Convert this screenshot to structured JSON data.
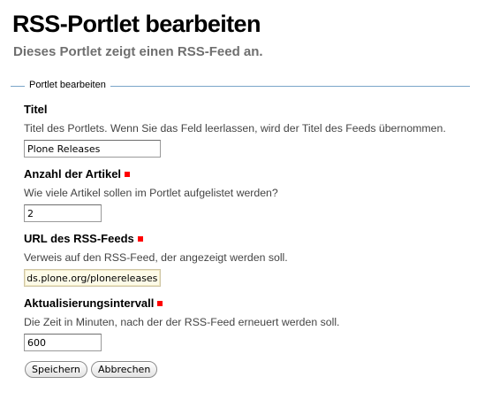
{
  "page": {
    "title": "RSS-Portlet bearbeiten",
    "description": "Dieses Portlet zeigt einen RSS-Feed an."
  },
  "form": {
    "legend": "Portlet bearbeiten",
    "required_marker_color": "#ff0000",
    "fields": {
      "title": {
        "label": "Titel",
        "help": "Titel des Portlets. Wenn Sie das Feld leerlassen, wird der Titel des Feeds übernommen.",
        "value": "Plone Releases",
        "required": false
      },
      "count": {
        "label": "Anzahl der Artikel",
        "help": "Wie viele Artikel sollen im Portlet aufgelistet werden?",
        "value": "2",
        "required": true
      },
      "url": {
        "label": "URL des RSS-Feeds",
        "help": "Verweis auf den RSS-Feed, der angezeigt werden soll.",
        "value": "http://feeds.plone.org/plonereleases",
        "required": true
      },
      "timeout": {
        "label": "Aktualisierungsintervall",
        "help": "Die Zeit in Minuten, nach der der RSS-Feed erneuert werden soll.",
        "value": "600",
        "required": true
      }
    },
    "buttons": {
      "save": "Speichern",
      "cancel": "Abbrechen"
    }
  },
  "colors": {
    "fieldset_border": "#7aa6c9",
    "description_text": "#6f6f6f",
    "url_input_background": "#fdfbe8"
  }
}
